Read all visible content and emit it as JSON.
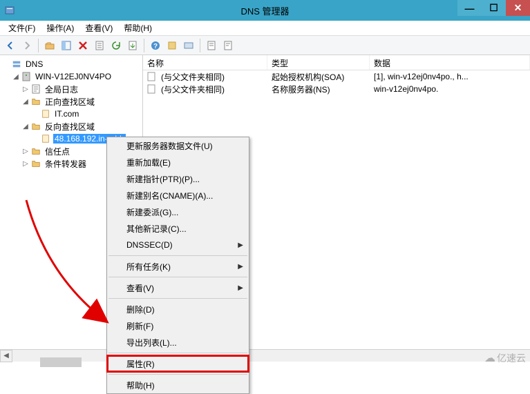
{
  "window": {
    "title": "DNS 管理器"
  },
  "menubar": {
    "file": "文件(F)",
    "action": "操作(A)",
    "view": "查看(V)",
    "help": "帮助(H)"
  },
  "tree": {
    "root": "DNS",
    "server": "WIN-V12EJ0NV4PO",
    "global_log": "全局日志",
    "forward_zone": "正向查找区域",
    "forward_item": "IT.com",
    "reverse_zone": "反向查找区域",
    "reverse_item": "48.168.192.in-addr",
    "trust_points": "信任点",
    "conditional_forwarders": "条件转发器"
  },
  "list": {
    "headers": {
      "name": "名称",
      "type": "类型",
      "data": "数据"
    },
    "rows": [
      {
        "name": "(与父文件夹相同)",
        "type": "起始授权机构(SOA)",
        "data": "[1], win-v12ej0nv4po., h..."
      },
      {
        "name": "(与父文件夹相同)",
        "type": "名称服务器(NS)",
        "data": "win-v12ej0nv4po."
      }
    ]
  },
  "context_menu": {
    "update_data_file": "更新服务器数据文件(U)",
    "reload": "重新加载(E)",
    "new_ptr": "新建指针(PTR)(P)...",
    "new_cname": "新建别名(CNAME)(A)...",
    "new_delegation": "新建委派(G)...",
    "other_records": "其他新记录(C)...",
    "dnssec": "DNSSEC(D)",
    "all_tasks": "所有任务(K)",
    "view": "查看(V)",
    "delete": "删除(D)",
    "refresh": "刷新(F)",
    "export_list": "导出列表(L)...",
    "properties": "属性(R)",
    "help": "帮助(H)"
  },
  "watermark": "亿速云"
}
